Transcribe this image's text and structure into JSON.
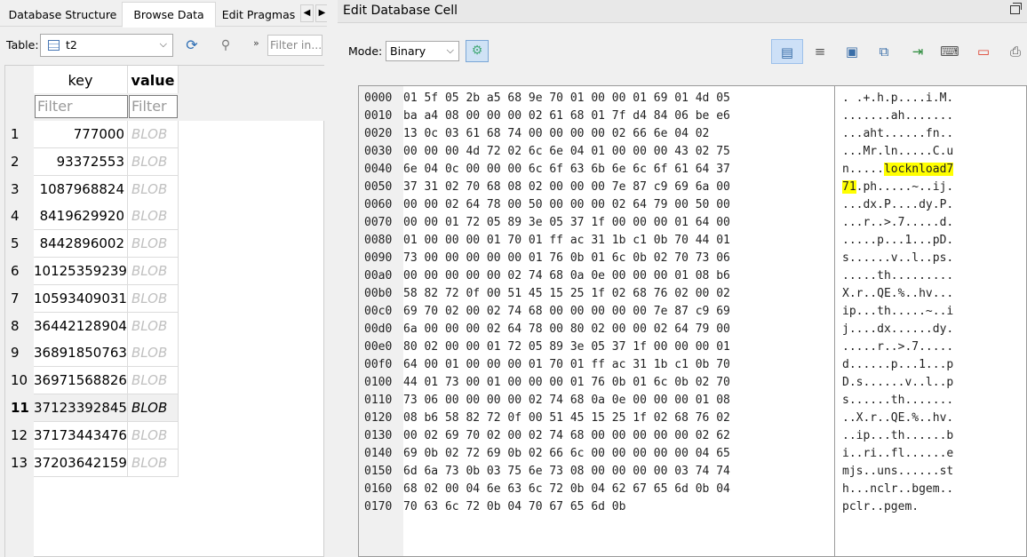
{
  "left_tabs": [
    {
      "label": "Database Structure",
      "active": false
    },
    {
      "label": "Browse Data",
      "active": true
    },
    {
      "label": "Edit Pragmas",
      "active": false
    }
  ],
  "tab_nav": {
    "prev": "◀",
    "next": "▶"
  },
  "table_selector": {
    "label": "Table:",
    "value": "t2"
  },
  "filter_all_placeholder": "Filter in...",
  "more_tools": "»",
  "grid": {
    "columns": [
      {
        "label": "key",
        "bold": false
      },
      {
        "label": "value",
        "bold": true
      }
    ],
    "filter_placeholder": "Filter",
    "rows": [
      {
        "n": "1",
        "key": "777000",
        "value": "BLOB"
      },
      {
        "n": "2",
        "key": "93372553",
        "value": "BLOB"
      },
      {
        "n": "3",
        "key": "1087968824",
        "value": "BLOB"
      },
      {
        "n": "4",
        "key": "8419629920",
        "value": "BLOB"
      },
      {
        "n": "5",
        "key": "8442896002",
        "value": "BLOB"
      },
      {
        "n": "6",
        "key": "10125359239",
        "value": "BLOB"
      },
      {
        "n": "7",
        "key": "10593409031",
        "value": "BLOB"
      },
      {
        "n": "8",
        "key": "36442128904",
        "value": "BLOB"
      },
      {
        "n": "9",
        "key": "36891850763",
        "value": "BLOB"
      },
      {
        "n": "10",
        "key": "36971568826",
        "value": "BLOB"
      },
      {
        "n": "11",
        "key": "37123392845",
        "value": "BLOB",
        "selected": true
      },
      {
        "n": "12",
        "key": "37173443476",
        "value": "BLOB"
      },
      {
        "n": "13",
        "key": "37203642159",
        "value": "BLOB"
      }
    ]
  },
  "edit_cell": {
    "title": "Edit Database Cell",
    "mode_label": "Mode:",
    "mode_value": "Binary"
  },
  "hex": [
    {
      "addr": "0000",
      "bytes": "01 5f 05 2b a5 68 9e 70 01 00 00 01 69 01 4d 05",
      "ascii": ". .+.h.p....i.M."
    },
    {
      "addr": "0010",
      "bytes": "ba a4 08 00 00 00 02 61 68 01 7f d4 84 06 be e6",
      "ascii": ".......ah......."
    },
    {
      "addr": "0020",
      "bytes": "13 0c 03 61 68 74 00 00 00 00 02 66 6e 04 02",
      "ascii": "...aht......fn.."
    },
    {
      "addr": "0030",
      "bytes": "00 00 00 4d 72 02 6c 6e 04 01 00 00 00 43 02 75",
      "ascii": "...Mr.ln.....C.u"
    },
    {
      "addr": "0040",
      "bytes": "6e 04 0c 00 00 00 6c 6f 63 6b 6e 6c 6f 61 64 37",
      "ascii_pre": "n.....",
      "ascii_hl": "locknload7",
      "ascii_post": ""
    },
    {
      "addr": "0050",
      "bytes": "37 31 02 70 68 08 02 00 00 00 7e 87 c9 69 6a 00",
      "ascii_pre": "",
      "ascii_hl": "71",
      "ascii_post": ".ph.....~..ij."
    },
    {
      "addr": "0060",
      "bytes": "00 00 02 64 78 00 50 00 00 00 02 64 79 00 50 00",
      "ascii": "...dx.P....dy.P."
    },
    {
      "addr": "0070",
      "bytes": "00 00 01 72 05 89 3e 05 37 1f 00 00 00 01 64 00",
      "ascii": "...r..>.7.....d."
    },
    {
      "addr": "0080",
      "bytes": "01 00 00 00 01 70 01 ff ac 31 1b c1 0b 70 44 01",
      "ascii": ".....p...1...pD."
    },
    {
      "addr": "0090",
      "bytes": "73 00 00 00 00 00 01 76 0b 01 6c 0b 02 70 73 06",
      "ascii": "s......v..l..ps."
    },
    {
      "addr": "00a0",
      "bytes": "00 00 00 00 00 02 74 68 0a 0e 00 00 00 01 08 b6",
      "ascii": ".....th........."
    },
    {
      "addr": "00b0",
      "bytes": "58 82 72 0f 00 51 45 15 25 1f 02 68 76 02 00 02",
      "ascii": "X.r..QE.%..hv..."
    },
    {
      "addr": "00c0",
      "bytes": "69 70 02 00 02 74 68 00 00 00 00 00 7e 87 c9 69",
      "ascii": "ip...th.....~..i"
    },
    {
      "addr": "00d0",
      "bytes": "6a 00 00 00 02 64 78 00 80 02 00 00 02 64 79 00",
      "ascii": "j....dx......dy."
    },
    {
      "addr": "00e0",
      "bytes": "80 02 00 00 01 72 05 89 3e 05 37 1f 00 00 00 01",
      "ascii": ".....r..>.7....."
    },
    {
      "addr": "00f0",
      "bytes": "64 00 01 00 00 00 01 70 01 ff ac 31 1b c1 0b 70",
      "ascii": "d......p...1...p"
    },
    {
      "addr": "0100",
      "bytes": "44 01 73 00 01 00 00 00 01 76 0b 01 6c 0b 02 70",
      "ascii": "D.s......v..l..p"
    },
    {
      "addr": "0110",
      "bytes": "73 06 00 00 00 00 02 74 68 0a 0e 00 00 00 01 08",
      "ascii": "s......th......."
    },
    {
      "addr": "0120",
      "bytes": "08 b6 58 82 72 0f 00 51 45 15 25 1f 02 68 76 02",
      "ascii": "..X.r..QE.%..hv."
    },
    {
      "addr": "0130",
      "bytes": "00 02 69 70 02 00 02 74 68 00 00 00 00 00 02 62",
      "ascii": "..ip...th......b"
    },
    {
      "addr": "0140",
      "bytes": "69 0b 02 72 69 0b 02 66 6c 00 00 00 00 00 04 65",
      "ascii": "i..ri..fl......e"
    },
    {
      "addr": "0150",
      "bytes": "6d 6a 73 0b 03 75 6e 73 08 00 00 00 00 03 74 74",
      "ascii": "mjs..uns......st"
    },
    {
      "addr": "0160",
      "bytes": "68 02 00 04 6e 63 6c 72 0b 04 62 67 65 6d 0b 04",
      "ascii": "h...nclr..bgem.."
    },
    {
      "addr": "0170",
      "bytes": "70 63 6c 72 0b 04 70 67 65 6d 0b",
      "ascii": "pclr..pgem."
    }
  ]
}
